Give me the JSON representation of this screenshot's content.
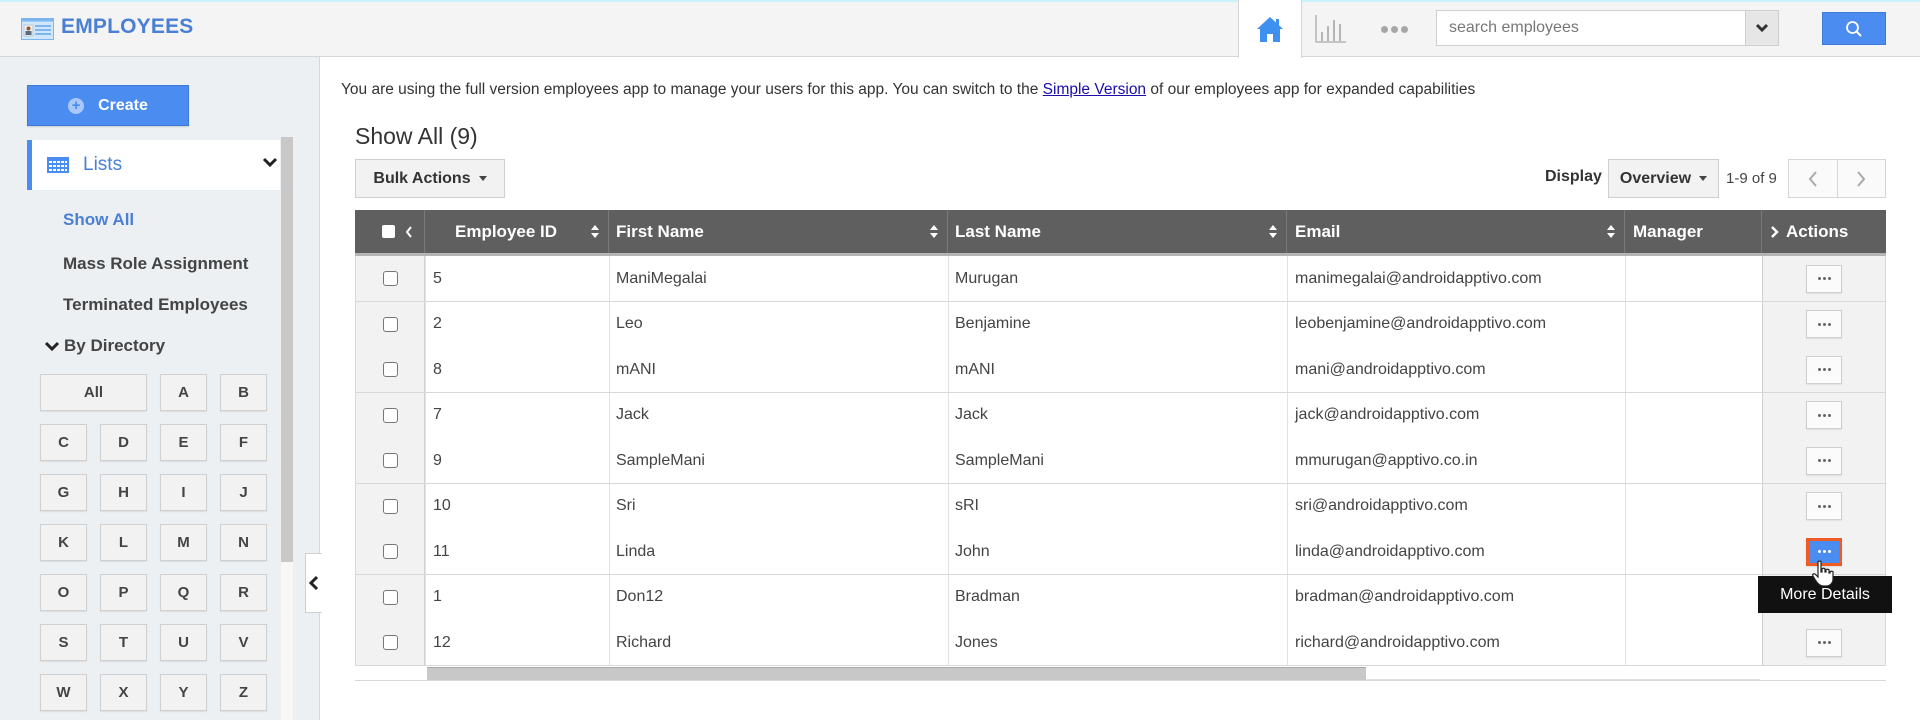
{
  "header": {
    "app_title": "EMPLOYEES",
    "search": {
      "placeholder": "search employees",
      "value": ""
    },
    "nav": {
      "home": "home-icon",
      "reports": "bar-chart-icon",
      "more": "more-icon"
    }
  },
  "sidebar": {
    "create_label": "Create",
    "lists_label": "Lists",
    "links": [
      {
        "label": "Show All",
        "active": true
      },
      {
        "label": "Mass Role Assignment",
        "active": false
      },
      {
        "label": "Terminated Employees",
        "active": false
      }
    ],
    "by_directory_label": "By Directory",
    "alphabet": [
      "All",
      "A",
      "B",
      "C",
      "D",
      "E",
      "F",
      "G",
      "H",
      "I",
      "J",
      "K",
      "L",
      "M",
      "N",
      "O",
      "P",
      "Q",
      "R",
      "S",
      "T",
      "U",
      "V",
      "W",
      "X",
      "Y",
      "Z"
    ]
  },
  "main": {
    "info": {
      "before": "You are using the full version employees app to manage your users for this app. You can switch to the ",
      "link": "Simple Version",
      "after": " of our employees app for expanded capabilities"
    },
    "title": "Show All (9)",
    "bulk_actions_label": "Bulk Actions",
    "display_label": "Display",
    "display_value": "Overview",
    "page_range": "1-9 of 9",
    "columns": [
      "Employee ID",
      "First Name",
      "Last Name",
      "Email",
      "Manager",
      "Actions"
    ],
    "rows": [
      {
        "id": "5",
        "first": "ManiMegalai",
        "last": "Murugan",
        "email": "manimegalai@androidapptivo.com",
        "manager": ""
      },
      {
        "id": "2",
        "first": "Leo",
        "last": "Benjamine",
        "email": "leobenjamine@androidapptivo.com",
        "manager": ""
      },
      {
        "id": "8",
        "first": "mANI",
        "last": "mANI",
        "email": "mani@androidapptivo.com",
        "manager": ""
      },
      {
        "id": "7",
        "first": "Jack",
        "last": "Jack",
        "email": "jack@androidapptivo.com",
        "manager": ""
      },
      {
        "id": "9",
        "first": "SampleMani",
        "last": "SampleMani",
        "email": "mmurugan@apptivo.co.in",
        "manager": ""
      },
      {
        "id": "10",
        "first": "Sri",
        "last": "sRI",
        "email": "sri@androidapptivo.com",
        "manager": ""
      },
      {
        "id": "11",
        "first": "Linda",
        "last": "John",
        "email": "linda@androidapptivo.com",
        "manager": ""
      },
      {
        "id": "1",
        "first": "Don12",
        "last": "Bradman",
        "email": "bradman@androidapptivo.com",
        "manager": ""
      },
      {
        "id": "12",
        "first": "Richard",
        "last": "Jones",
        "email": "richard@androidapptivo.com",
        "manager": ""
      }
    ],
    "active_action_row": 6,
    "tooltip": "More Details"
  },
  "colors": {
    "brand": "#4a7fd4",
    "primary_button": "#4a8cf0",
    "table_header": "#5f5f5f",
    "highlight_border": "#f05a23"
  }
}
